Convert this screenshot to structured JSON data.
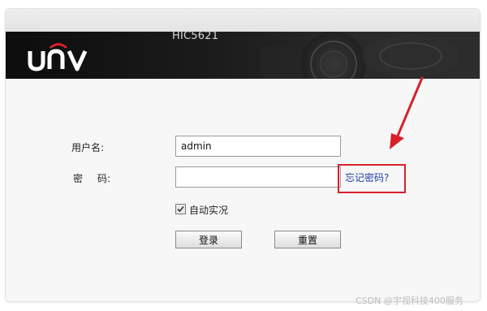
{
  "brand": {
    "logo_text": "UNV",
    "model": "HIC5621",
    "banner_bg": "#1a1a1a",
    "logo_accent": "#d8202a"
  },
  "form": {
    "username_label": "用户名:",
    "password_label_a": "密",
    "password_label_b": "码:",
    "username_value": "admin",
    "password_value": "",
    "forgot_link": "忘记密码?",
    "auto_login_label": "自动实况",
    "auto_login_checked": true,
    "login_button": "登录",
    "reset_button": "重置"
  },
  "annotation": {
    "highlight_color": "#d8202a"
  },
  "watermark": "CSDN @宇视科技400服务"
}
